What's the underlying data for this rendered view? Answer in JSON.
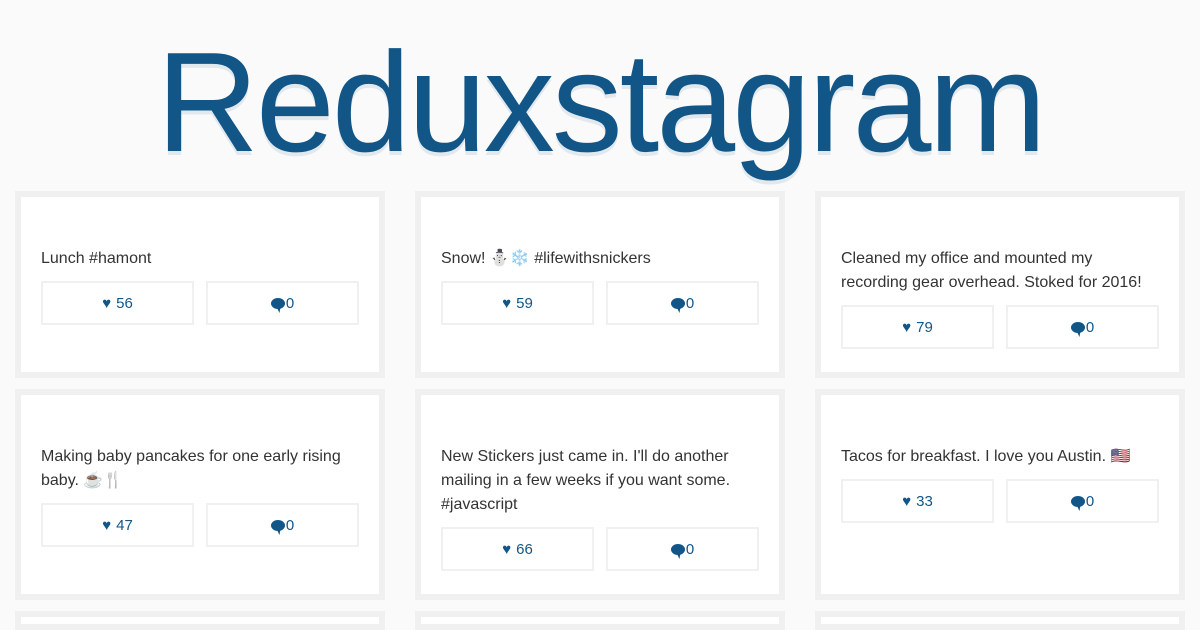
{
  "app": {
    "title": "Reduxstagram",
    "brand_color": "#125688"
  },
  "posts": [
    {
      "caption": "Lunch #hamont",
      "likes": "56",
      "comments": "0"
    },
    {
      "caption": "Snow! ⛄️❄️ #lifewithsnickers",
      "likes": "59",
      "comments": "0"
    },
    {
      "caption": "Cleaned my office and mounted my recording gear overhead. Stoked for 2016!",
      "likes": "79",
      "comments": "0"
    },
    {
      "caption": "Making baby pancakes for one early rising baby. ☕️🍴",
      "likes": "47",
      "comments": "0"
    },
    {
      "caption": "New Stickers just came in. I'll do another mailing in a few weeks if you want some. #javascript",
      "likes": "66",
      "comments": "0"
    },
    {
      "caption": "Tacos for breakfast. I love you Austin. 🇺🇸",
      "likes": "33",
      "comments": "0"
    }
  ],
  "icons": {
    "like": "heart-icon",
    "comment": "speech-bubble-icon"
  }
}
